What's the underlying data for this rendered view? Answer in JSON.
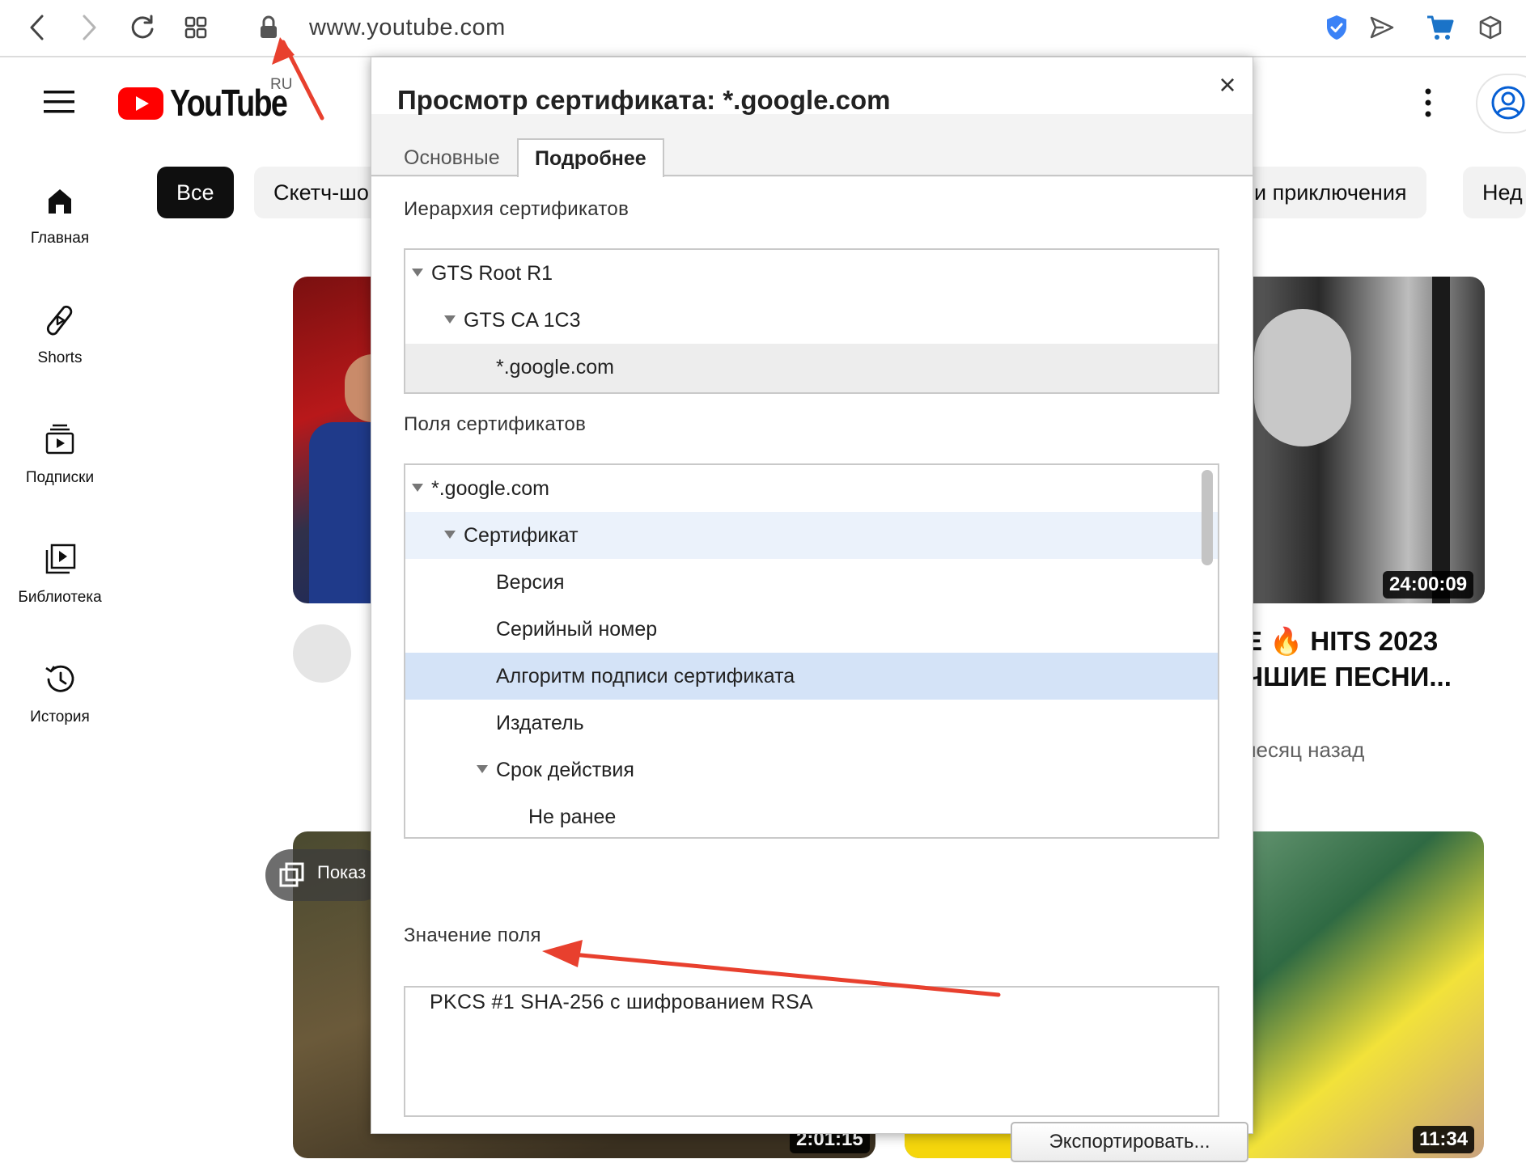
{
  "browser": {
    "url": "www.youtube.com",
    "icons": [
      "back-icon",
      "forward-icon",
      "reload-icon",
      "tabs-grid-icon",
      "lock-icon",
      "shield-check-icon",
      "send-icon",
      "cart-icon",
      "box-icon"
    ]
  },
  "youtube": {
    "logo_text": "YouTube",
    "region": "RU",
    "sidebar": [
      {
        "label": "Главная",
        "icon": "home-icon"
      },
      {
        "label": "Shorts",
        "icon": "shorts-icon"
      },
      {
        "label": "Подписки",
        "icon": "subscriptions-icon"
      },
      {
        "label": "Библиотека",
        "icon": "library-icon"
      },
      {
        "label": "История",
        "icon": "history-icon"
      }
    ],
    "chips": [
      "Все",
      "Скетч-шо",
      "и приключения",
      "Нед"
    ],
    "videos": [
      {
        "duration": "24:00:09",
        "title_line1": "E 🔥 HITS 2023",
        "title_line2": "ЧШИЕ ПЕСНИ...",
        "meta": "иесяц назад"
      },
      {
        "overlay": "Показ",
        "duration": "2:01:15"
      },
      {
        "duration": "11:34"
      }
    ]
  },
  "dialog": {
    "title": "Просмотр сертификата: *.google.com",
    "close": "×",
    "tabs": {
      "basic": "Основные",
      "details": "Подробнее"
    },
    "hierarchy_label": "Иерархия сертификатов",
    "hierarchy": [
      "GTS Root R1",
      "GTS CA 1C3",
      "*.google.com"
    ],
    "fields_label": "Поля сертификатов",
    "fields": [
      "*.google.com",
      "Сертификат",
      "Версия",
      "Серийный номер",
      "Алгоритм подписи сертификата",
      "Издатель",
      "Срок действия",
      "Не ранее"
    ],
    "value_label": "Значение поля",
    "value": "PKCS #1 SHA-256 с шифрованием RSA",
    "export_button": "Экспортировать..."
  },
  "colors": {
    "youtube_red": "#ff0000",
    "selection_blue": "#d4e3f7",
    "row_hover": "#ebf2fb",
    "annotation_arrow": "#e8402e"
  }
}
